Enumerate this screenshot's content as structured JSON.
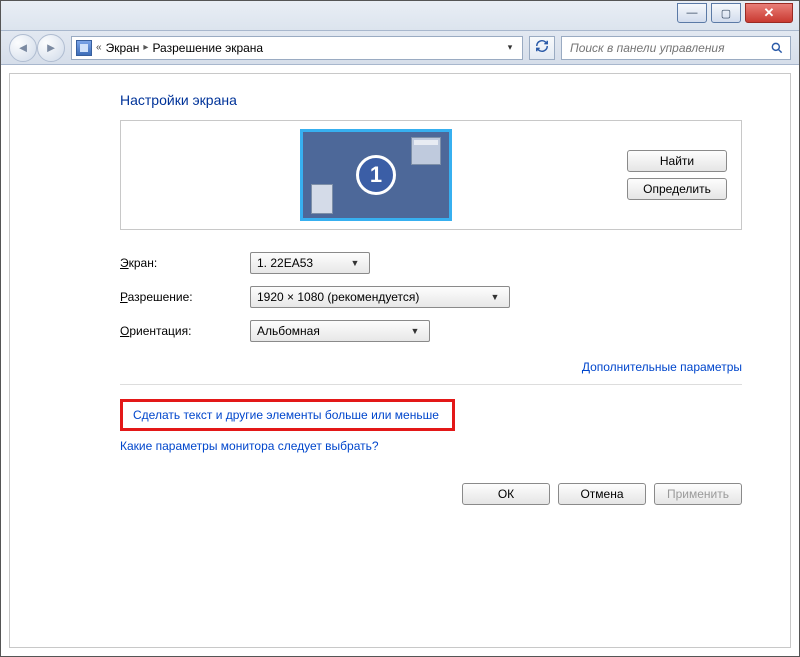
{
  "titlebar": {
    "minimize_glyph": "—",
    "maximize_glyph": "▢",
    "close_glyph": "✕"
  },
  "addressbar": {
    "chevrons": "«",
    "crumb1": "Экран",
    "crumb2": "Разрешение экрана",
    "sep": "▸",
    "dd": "▾",
    "refresh_glyph": "↻"
  },
  "search": {
    "placeholder": "Поиск в панели управления",
    "icon_glyph": "🔍"
  },
  "content": {
    "title": "Настройки экрана",
    "monitor_number": "1",
    "find_btn": "Найти",
    "identify_btn": "Определить",
    "screen_label": "Экран:",
    "screen_value": "1. 22EA53",
    "resolution_label": "Разрешение:",
    "resolution_value": "1920 × 1080 (рекомендуется)",
    "orientation_label": "Ориентация:",
    "orientation_value": "Альбомная",
    "advanced_link": "Дополнительные параметры",
    "scale_link": "Сделать текст и другие элементы больше или меньше",
    "help_link": "Какие параметры монитора следует выбрать?",
    "ok_btn": "ОК",
    "cancel_btn": "Отмена",
    "apply_btn": "Применить"
  }
}
